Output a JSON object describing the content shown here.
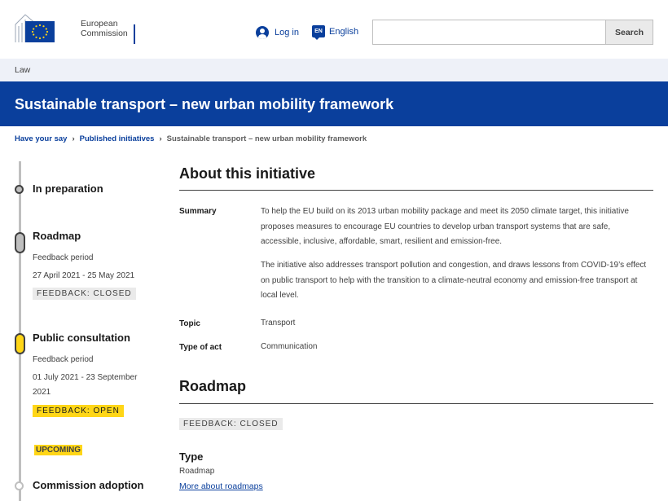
{
  "header": {
    "logo_line1": "European",
    "logo_line2": "Commission",
    "login_label": "Log in",
    "language_code": "EN",
    "language_label": "English",
    "search_placeholder": "",
    "search_button": "Search"
  },
  "law_link": "Law",
  "page_title": "Sustainable transport – new urban mobility framework",
  "breadcrumb": {
    "item1": "Have your say",
    "item2": "Published initiatives",
    "current": "Sustainable transport – new urban mobility framework",
    "separator": "›"
  },
  "timeline": {
    "in_preparation": "In preparation",
    "roadmap": {
      "title": "Roadmap",
      "period_label": "Feedback period",
      "dates": "27 April 2021 - 25 May 2021",
      "status": "FEEDBACK: CLOSED"
    },
    "public_consultation": {
      "title": "Public consultation",
      "period_label": "Feedback period",
      "dates_line1": "01 July 2021 - 23 September",
      "dates_line2": "2021",
      "status": "FEEDBACK: OPEN"
    },
    "upcoming": "UPCOMING",
    "commission_adoption": "Commission adoption"
  },
  "about": {
    "title": "About this initiative",
    "summary_label": "Summary",
    "summary_p1": "To help the EU build on its 2013 urban mobility package and meet its 2050 climate target, this initiative proposes measures to encourage EU countries to develop urban transport systems that are safe, accessible, inclusive, affordable, smart, resilient and emission-free.",
    "summary_p2": "The initiative also addresses transport pollution and congestion, and draws lessons from COVID-19’s effect on public transport to help with the transition to a climate-neutral economy and emission-free transport at local level.",
    "topic_label": "Topic",
    "topic_value": "Transport",
    "type_of_act_label": "Type of act",
    "type_of_act_value": "Communication"
  },
  "roadmap_section": {
    "title": "Roadmap",
    "status": "FEEDBACK: CLOSED",
    "type_heading": "Type",
    "type_value": "Roadmap",
    "more_link": "More about roadmaps"
  },
  "colors": {
    "brand_blue": "#0a3f9c",
    "highlight_yellow": "#ffd617",
    "tag_grey": "#eaeaea"
  }
}
